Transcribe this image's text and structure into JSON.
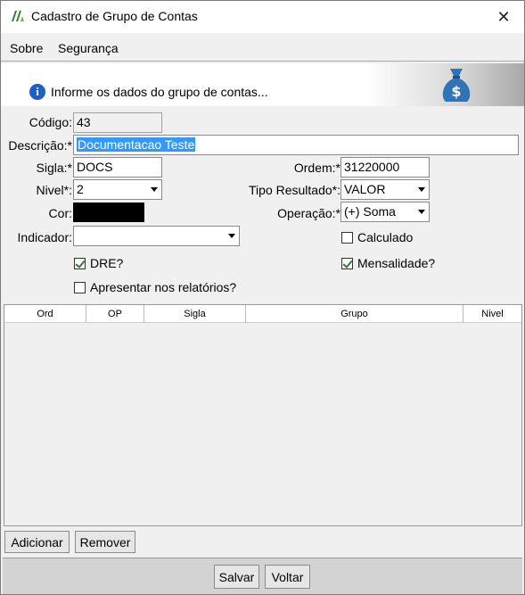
{
  "window": {
    "title": "Cadastro de Grupo de Contas",
    "close_symbol": "✕"
  },
  "menu": {
    "sobre": "Sobre",
    "seguranca": "Segurança"
  },
  "header": {
    "info_symbol": "i",
    "message": "Informe os dados do grupo de contas..."
  },
  "form": {
    "codigo_label": "Código:",
    "codigo_value": "43",
    "descricao_label": "Descrição:*",
    "descricao_value": "Documentacao Teste",
    "sigla_label": "Sigla:*",
    "sigla_value": "DOCS",
    "ordem_label": "Ordem:*",
    "ordem_value": "31220000",
    "nivel_label": "Nivel*:",
    "nivel_value": "2",
    "tipo_resultado_label": "Tipo Resultado*:",
    "tipo_resultado_value": "VALOR",
    "cor_label": "Cor:",
    "cor_value": "#000000",
    "operacao_label": "Operação:*",
    "operacao_value": "(+) Soma",
    "indicador_label": "Indicador:",
    "indicador_value": "",
    "calculado_label": "Calculado",
    "calculado_checked": false,
    "dre_label": "DRE?",
    "dre_checked": true,
    "mensalidade_label": "Mensalidade?",
    "mensalidade_checked": true,
    "apresentar_label": "Apresentar nos relatórios?",
    "apresentar_checked": false
  },
  "grid": {
    "columns": [
      "Ord",
      "OP",
      "Sigla",
      "Grupo",
      "Nivel"
    ],
    "rows": []
  },
  "buttons": {
    "adicionar": "Adicionar",
    "remover": "Remover",
    "salvar": "Salvar",
    "voltar": "Voltar"
  },
  "colors": {
    "check_green": "#2e7d32",
    "selection_blue": "#3399ff",
    "info_blue": "#1d5ec9",
    "money_bag": "#2f74b8"
  }
}
